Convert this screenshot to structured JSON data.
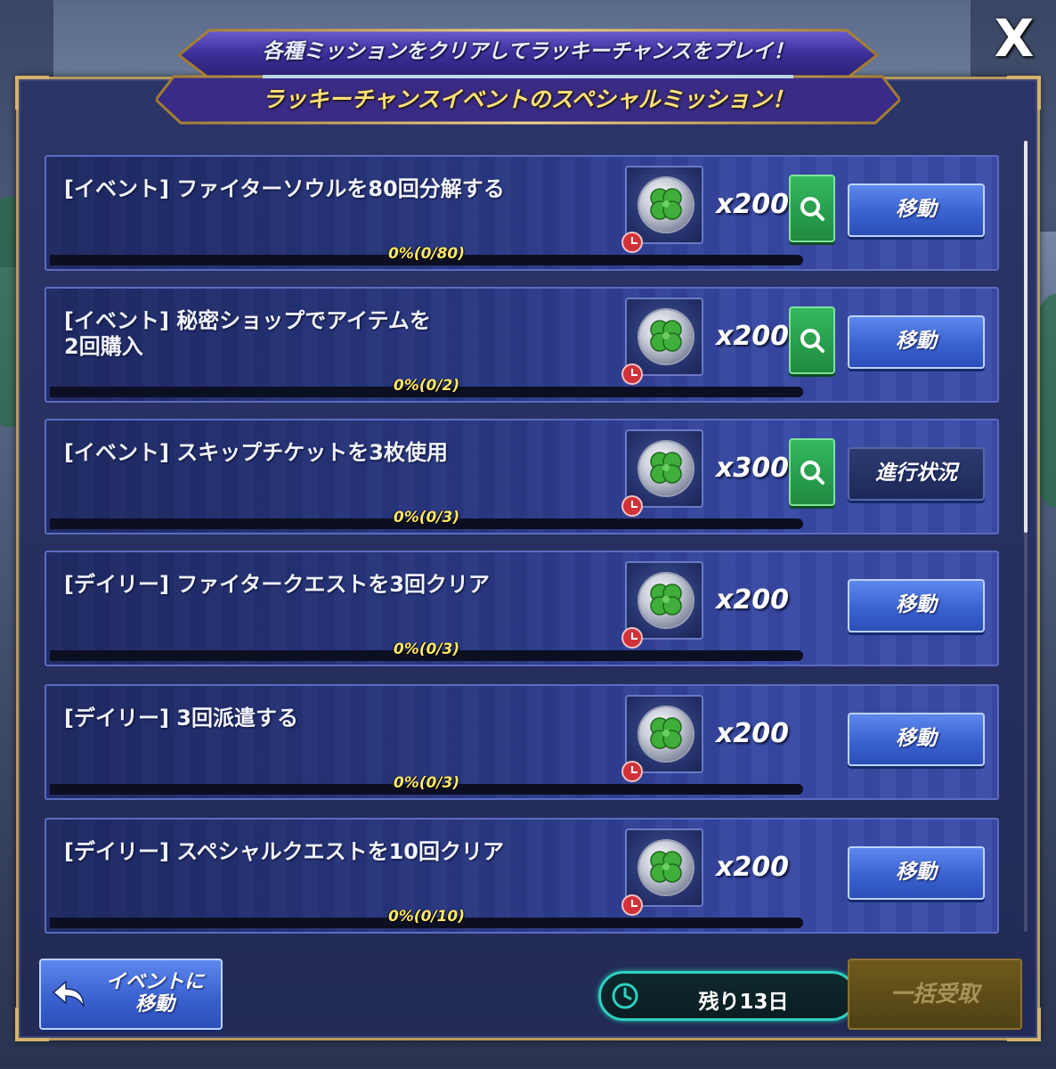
{
  "header": {
    "line1": "各種ミッションをクリアしてラッキーチャンスをプレイ！",
    "line2": "ラッキーチャンスイベントのスペシャルミッション！",
    "close_label": "X"
  },
  "missions": [
    {
      "title": "[イベント] ファイターソウルを80回分解する",
      "progress": "0%(0/80)",
      "reward_qty": "x200",
      "action": "移動",
      "has_search": true,
      "reward_icon": "clover-medal-icon"
    },
    {
      "title": "[イベント] 秘密ショップでアイテムを\n2回購入",
      "progress": "0%(0/2)",
      "reward_qty": "x200",
      "action": "移動",
      "has_search": true,
      "reward_icon": "clover-medal-icon"
    },
    {
      "title": "[イベント] スキップチケットを3枚使用",
      "progress": "0%(0/3)",
      "reward_qty": "x300",
      "action": "進行状況",
      "has_search": true,
      "reward_icon": "clover-medal-icon"
    },
    {
      "title": "[デイリー] ファイタークエストを3回クリア",
      "progress": "0%(0/3)",
      "reward_qty": "x200",
      "action": "移動",
      "has_search": false,
      "reward_icon": "clover-medal-icon"
    },
    {
      "title": "[デイリー] 3回派遣する",
      "progress": "0%(0/3)",
      "reward_qty": "x200",
      "action": "移動",
      "has_search": false,
      "reward_icon": "clover-medal-icon"
    },
    {
      "title": "[デイリー] スペシャルクエストを10回クリア",
      "progress": "0%(0/10)",
      "reward_qty": "x200",
      "action": "移動",
      "has_search": false,
      "reward_icon": "clover-medal-icon"
    }
  ],
  "footer": {
    "back_label": "イベントに\n移動",
    "remaining": "残り13日",
    "claim_all": "一括受取"
  },
  "colors": {
    "accent_gold": "#ffe07a",
    "action_blue": "#3a62cf",
    "search_green": "#1f8a40",
    "timer_teal": "#2fd0c0",
    "progress_yellow": "#ffe86a"
  }
}
